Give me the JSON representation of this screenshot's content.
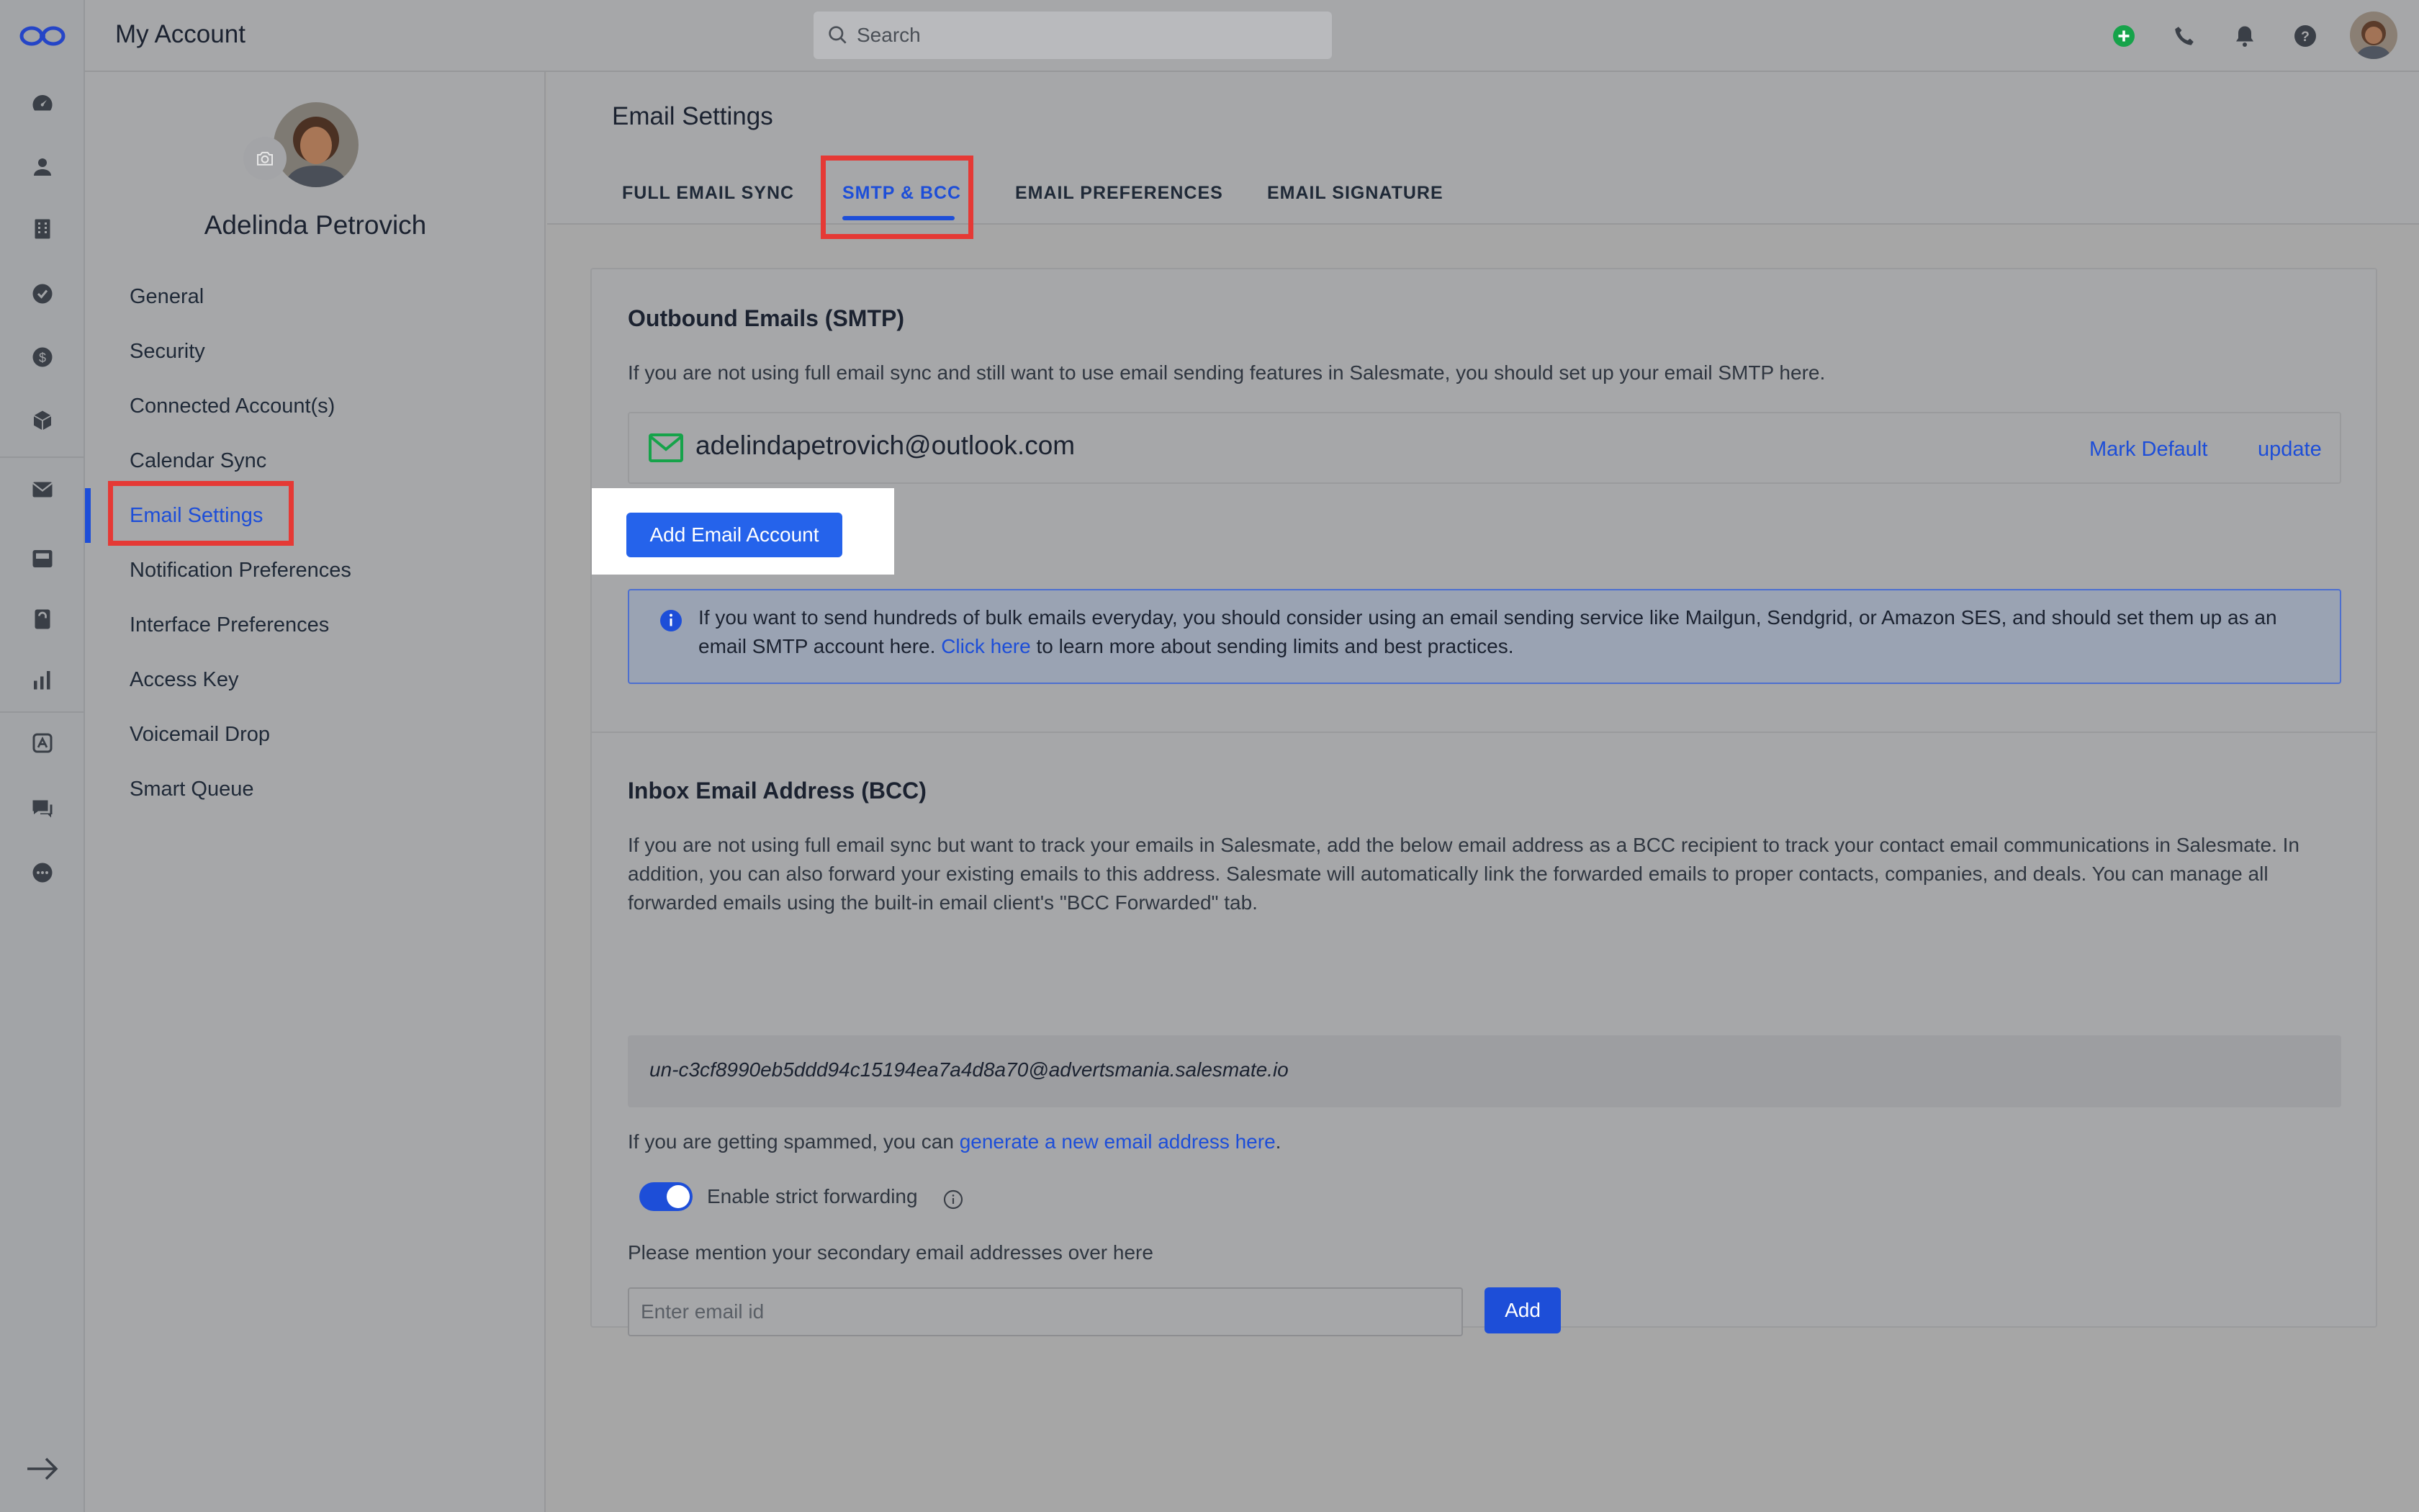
{
  "header": {
    "title": "My Account",
    "search_placeholder": "Search"
  },
  "profile": {
    "name": "Adelinda Petrovich"
  },
  "sidebar": {
    "items": [
      {
        "label": "General"
      },
      {
        "label": "Security"
      },
      {
        "label": "Connected Account(s)"
      },
      {
        "label": "Calendar Sync"
      },
      {
        "label": "Email Settings",
        "active": true
      },
      {
        "label": "Notification Preferences"
      },
      {
        "label": "Interface Preferences"
      },
      {
        "label": "Access Key"
      },
      {
        "label": "Voicemail Drop"
      },
      {
        "label": "Smart Queue"
      }
    ]
  },
  "rail": {
    "icons": [
      "logo-icon",
      "dashboard-icon",
      "contacts-icon",
      "companies-icon",
      "tasks-icon",
      "deals-icon",
      "products-icon",
      "email-icon",
      "inbox-icon",
      "calls-icon",
      "reports-icon",
      "automation-icon",
      "chat-icon",
      "more-icon",
      "expand-arrow-icon"
    ]
  },
  "main": {
    "title": "Email Settings",
    "tabs": [
      {
        "label": "FULL EMAIL SYNC"
      },
      {
        "label": "SMTP & BCC",
        "active": true
      },
      {
        "label": "EMAIL PREFERENCES"
      },
      {
        "label": "EMAIL SIGNATURE"
      }
    ]
  },
  "smtp": {
    "title": "Outbound Emails (SMTP)",
    "description": "If you are not using full email sync and still want to use email sending features in Salesmate, you should set up your email SMTP here.",
    "account_email": "adelindapetrovich@outlook.com",
    "mark_default": "Mark Default",
    "update": "update",
    "add_button": "Add Email Account",
    "info_text_before": "If you want to send hundreds of bulk emails everyday, you should consider using an email sending service like Mailgun, Sendgrid, or Amazon SES, and should set them up as an email SMTP account here. ",
    "info_link": "Click here",
    "info_text_after": " to learn more about sending limits and best practices."
  },
  "bcc": {
    "title": "Inbox Email Address (BCC)",
    "description": "If you are not using full email sync but want to track your emails in Salesmate, add the below email address as a BCC recipient to track your contact email communications in Salesmate. In addition, you can also forward your existing emails to this address. Salesmate will automatically link the forwarded emails to proper contacts, companies, and deals. You can manage all forwarded emails using the built-in email client's \"BCC Forwarded\" tab.",
    "address": "un-c3cf8990eb5ddd94c15194ea7a4d8a70@advertsmania.salesmate.io",
    "spam_text": "If you are getting spammed, you can ",
    "spam_link": "generate a new email address here",
    "spam_end": ".",
    "toggle_label": "Enable strict forwarding",
    "toggle_on": true,
    "secondary_label": "Please mention your secondary email addresses over here",
    "secondary_placeholder": "Enter email id",
    "secondary_add": "Add"
  },
  "colors": {
    "accent": "#1d4ed8",
    "button": "#2563eb",
    "highlight": "#e53935",
    "success": "#16a34a"
  }
}
